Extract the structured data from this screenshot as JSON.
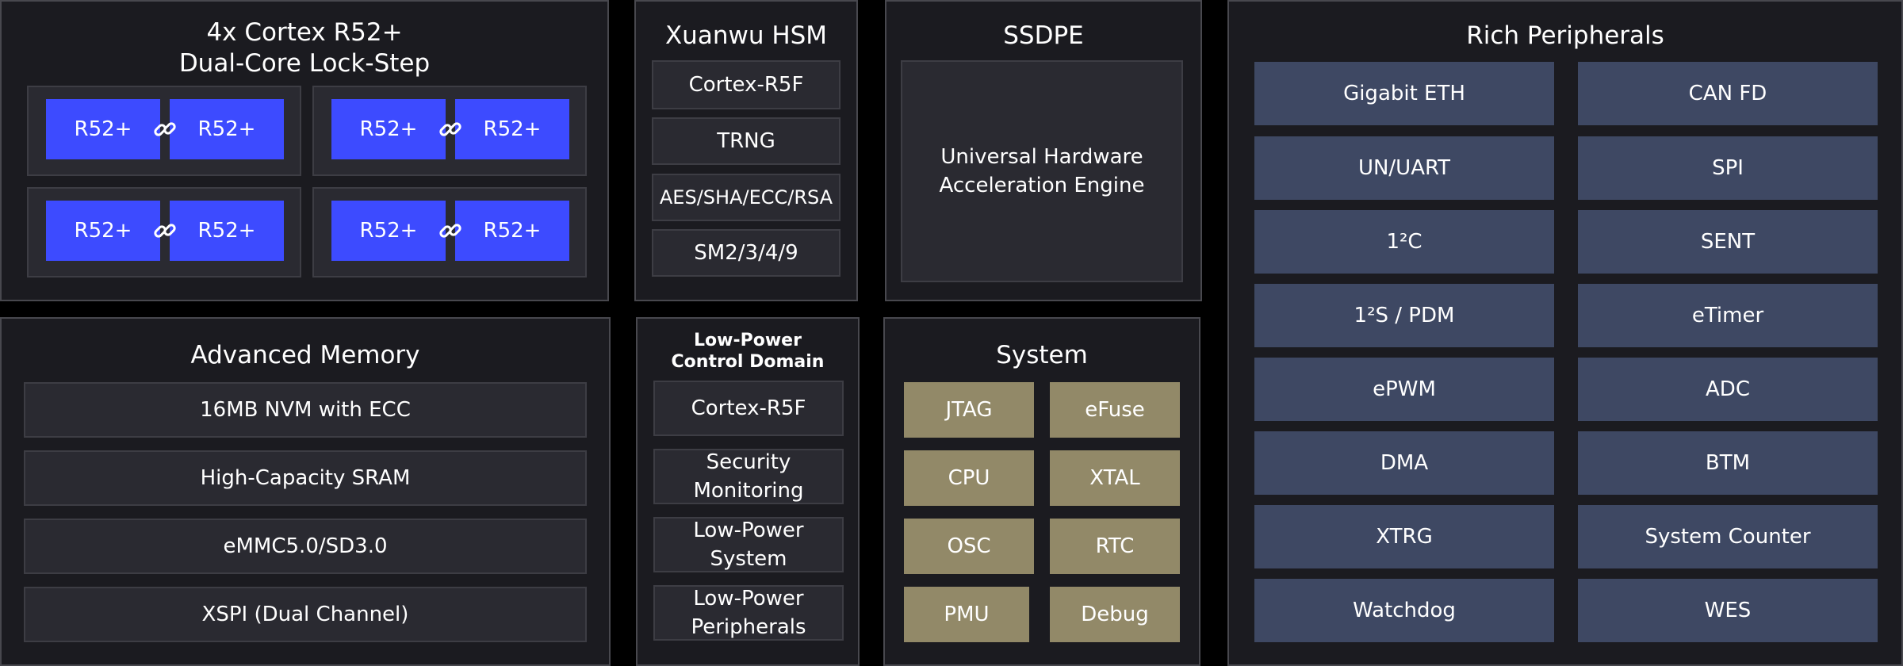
{
  "cores": {
    "title_line1": "4x Cortex R52+",
    "title_line2": "Dual-Core Lock-Step",
    "core_label": "R52+",
    "link_icon": "chain-link-icon",
    "core_color": "#3d4bff"
  },
  "hsm": {
    "title": "Xuanwu HSM",
    "items": [
      "Cortex-R5F",
      "TRNG",
      "AES/SHA/ECC/RSA",
      "SM2/3/4/9"
    ]
  },
  "ssdpe": {
    "title": "SSDPE",
    "engine_line1": "Universal Hardware",
    "engine_line2": "Acceleration Engine"
  },
  "peripherals": {
    "title": "Rich Peripherals",
    "items": [
      "Gigabit ETH",
      "CAN FD",
      "UN/UART",
      "SPI",
      "1²C",
      "SENT",
      "1²S / PDM",
      "eTimer",
      "ePWM",
      "ADC",
      "DMA",
      "BTM",
      "XTRG",
      "System Counter",
      "Watchdog",
      "WES"
    ],
    "color": "#3e4863"
  },
  "memory": {
    "title": "Advanced Memory",
    "items": [
      "16MB NVM with ECC",
      "High-Capacity SRAM",
      "eMMC5.0/SD3.0",
      "XSPI (Dual Channel)"
    ]
  },
  "lowpower": {
    "title_line1": "Low-Power",
    "title_line2": "Control Domain",
    "items": [
      {
        "line1": "Cortex-R5F",
        "line2": ""
      },
      {
        "line1": "Security",
        "line2": "Monitoring"
      },
      {
        "line1": "Low-Power",
        "line2": "System"
      },
      {
        "line1": "Low-Power",
        "line2": "Peripherals"
      }
    ]
  },
  "system": {
    "title": "System",
    "items": [
      "JTAG",
      "eFuse",
      "CPU",
      "XTAL",
      "OSC",
      "RTC",
      "PMU",
      "Debug"
    ],
    "color": "#928968"
  }
}
